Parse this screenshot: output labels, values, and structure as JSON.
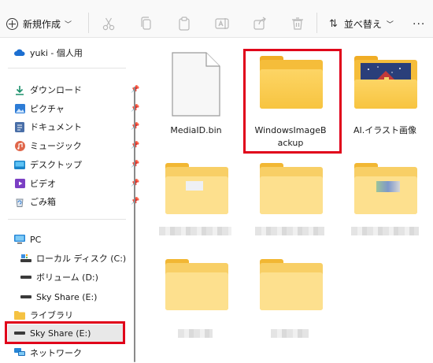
{
  "toolbar": {
    "new_label": "新規作成",
    "sort_label": "並べ替え",
    "more": "..."
  },
  "sidebar": {
    "user": "yuki - 個人用",
    "quick": [
      {
        "label": "ダウンロード",
        "icon": "download-icon"
      },
      {
        "label": "ピクチャ",
        "icon": "pictures-icon"
      },
      {
        "label": "ドキュメント",
        "icon": "documents-icon"
      },
      {
        "label": "ミュージック",
        "icon": "music-icon"
      },
      {
        "label": "デスクトップ",
        "icon": "desktop-icon"
      },
      {
        "label": "ビデオ",
        "icon": "video-icon"
      },
      {
        "label": "ごみ箱",
        "icon": "recycle-bin-icon"
      }
    ],
    "pc": "PC",
    "drives": [
      "ローカル ディスク (C:)",
      "ボリューム (D:)",
      "Sky Share (E:)"
    ],
    "library": "ライブラリ",
    "sky_share": "Sky Share (E:)",
    "network": "ネットワーク"
  },
  "files": {
    "mediaid": "MediaID.bin",
    "windows_backup_line1": "WindowsImageB",
    "windows_backup_line2": "ackup",
    "ai_folder": "AI.イラスト画像"
  },
  "colors": {
    "highlight": "#e0001a",
    "folder": "#f7c440"
  }
}
